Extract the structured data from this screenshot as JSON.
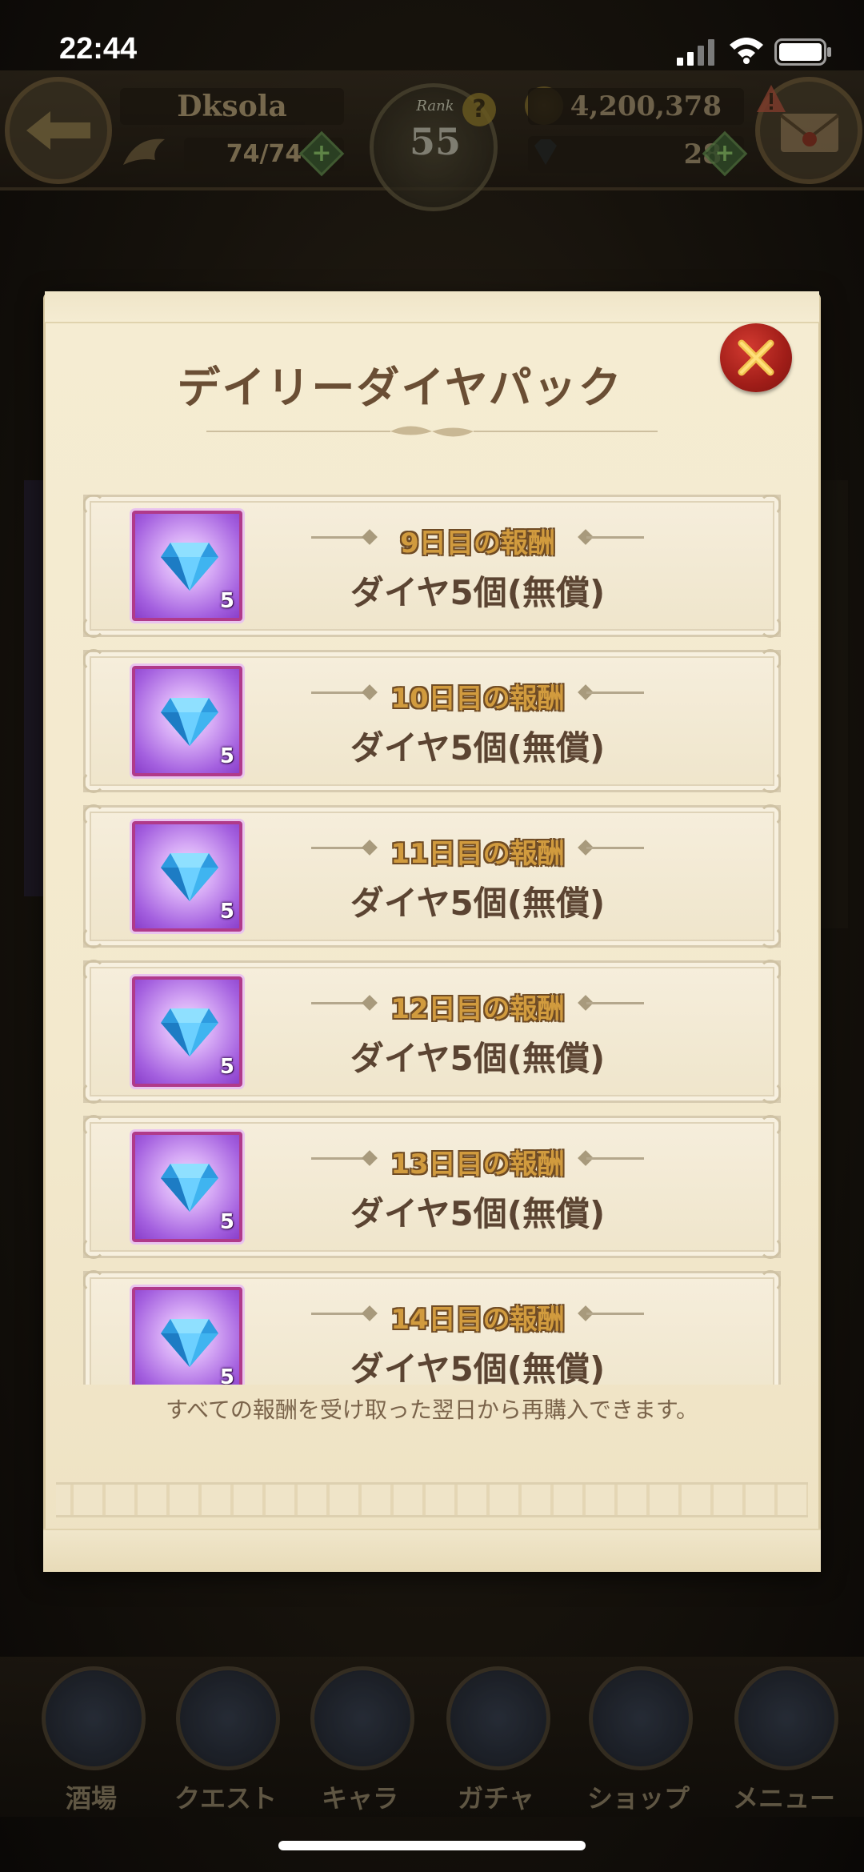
{
  "status_bar": {
    "time": "22:44"
  },
  "game_header": {
    "player_name": "Dksola",
    "stamina": "74/74",
    "rank_label": "Rank",
    "rank_value": "55",
    "gold": "4,200,378",
    "diamonds": "28"
  },
  "dialog": {
    "title": "デイリーダイヤパック",
    "close_icon": "close-x-icon",
    "rewards": [
      {
        "day_label": "9日目の報酬",
        "reward": "ダイヤ5個(無償)",
        "count": "5",
        "icon": "blue-diamond-icon"
      },
      {
        "day_label": "10日目の報酬",
        "reward": "ダイヤ5個(無償)",
        "count": "5",
        "icon": "blue-diamond-icon"
      },
      {
        "day_label": "11日目の報酬",
        "reward": "ダイヤ5個(無償)",
        "count": "5",
        "icon": "blue-diamond-icon"
      },
      {
        "day_label": "12日目の報酬",
        "reward": "ダイヤ5個(無償)",
        "count": "5",
        "icon": "blue-diamond-icon"
      },
      {
        "day_label": "13日目の報酬",
        "reward": "ダイヤ5個(無償)",
        "count": "5",
        "icon": "blue-diamond-icon"
      },
      {
        "day_label": "14日目の報酬",
        "reward": "ダイヤ5個(無償)",
        "count": "5",
        "icon": "blue-diamond-icon"
      }
    ],
    "footer_note": "すべての報酬を受け取った翌日から再購入できます。"
  },
  "bottom_nav": {
    "items": [
      {
        "label": "酒場",
        "icon": "tavern-icon"
      },
      {
        "label": "クエスト",
        "icon": "quest-scroll-icon"
      },
      {
        "label": "キャラ",
        "icon": "character-helmet-icon"
      },
      {
        "label": "ガチャ",
        "icon": "gacha-crystal-icon"
      },
      {
        "label": "ショップ",
        "icon": "shop-sign-icon"
      },
      {
        "label": "メニュー",
        "icon": "menu-gear-icon"
      }
    ]
  },
  "colors": {
    "parchment": "#f5ecd2",
    "title_brown": "#6a4e34",
    "day_label_gold": "#d19b3e",
    "close_red": "#c0291f",
    "item_purple": "#a460df",
    "gem_blue": "#3fb4f0"
  }
}
